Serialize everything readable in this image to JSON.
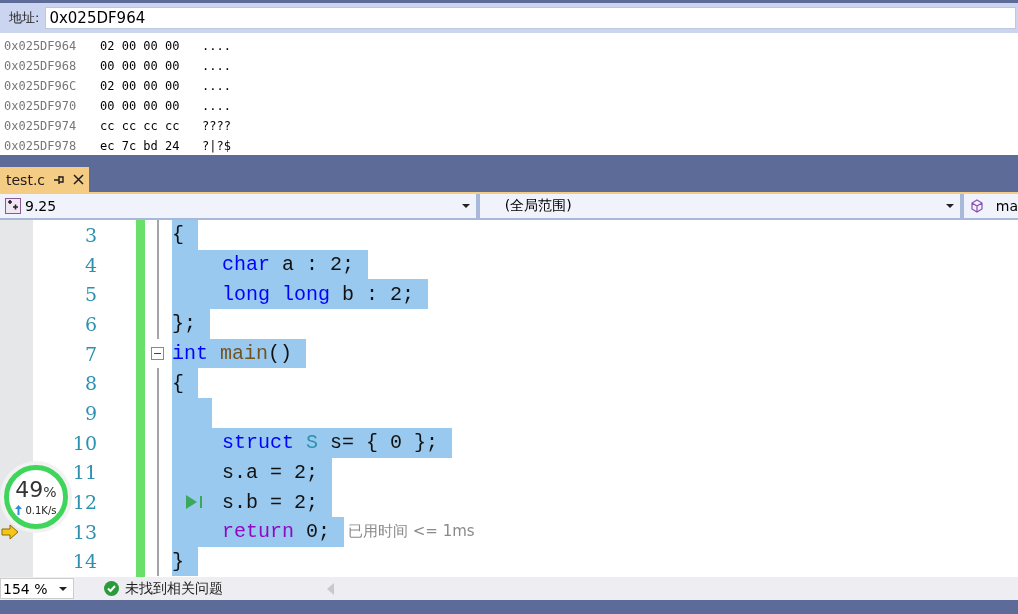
{
  "address_bar": {
    "label": "地址:",
    "value": "0x025DF964"
  },
  "memory_rows": [
    {
      "address": "0x025DF964",
      "bytes": "02 00 00 00",
      "chars": "...."
    },
    {
      "address": "0x025DF968",
      "bytes": "00 00 00 00",
      "chars": "...."
    },
    {
      "address": "0x025DF96C",
      "bytes": "02 00 00 00",
      "chars": "...."
    },
    {
      "address": "0x025DF970",
      "bytes": "00 00 00 00",
      "chars": "...."
    },
    {
      "address": "0x025DF974",
      "bytes": "cc cc cc cc",
      "chars": "????"
    },
    {
      "address": "0x025DF978",
      "bytes": "ec 7c bd 24",
      "chars": "?|?$"
    }
  ],
  "tabs": [
    {
      "label": "test.c",
      "selected": true
    }
  ],
  "nav_bar": {
    "project": "9.25",
    "scope": "(全局范围)",
    "member": "ma"
  },
  "code_lines": [
    {
      "number": "3",
      "selected": true,
      "tokens": [
        {
          "text": "{",
          "kind": "plain"
        }
      ]
    },
    {
      "number": "4",
      "selected": true,
      "indented": true,
      "tokens": [
        {
          "text": "char",
          "kind": "keyword"
        },
        {
          "text": " a : 2;",
          "kind": "plain"
        }
      ]
    },
    {
      "number": "5",
      "selected": true,
      "indented": true,
      "tokens": [
        {
          "text": "long long",
          "kind": "keyword"
        },
        {
          "text": " b : 2;",
          "kind": "plain"
        }
      ]
    },
    {
      "number": "6",
      "selected": true,
      "tokens": [
        {
          "text": "};",
          "kind": "plain"
        }
      ]
    },
    {
      "number": "7",
      "selected": true,
      "fold": true,
      "tokens": [
        {
          "text": "int ",
          "kind": "keyword"
        },
        {
          "text": "main",
          "kind": "function"
        },
        {
          "text": "()",
          "kind": "plain"
        }
      ]
    },
    {
      "number": "8",
      "selected": true,
      "tokens": [
        {
          "text": "{",
          "kind": "plain"
        }
      ]
    },
    {
      "number": "9",
      "selected": true
    },
    {
      "number": "10",
      "selected": true,
      "indented": true,
      "tokens": [
        {
          "text": "struct ",
          "kind": "keyword"
        },
        {
          "text": "S",
          "kind": "type"
        },
        {
          "text": " s= { 0 };",
          "kind": "plain"
        }
      ]
    },
    {
      "number": "11",
      "selected": true,
      "indented": true,
      "tokens": [
        {
          "text": "s.a = 2;",
          "kind": "plain"
        }
      ]
    },
    {
      "number": "12",
      "selected": true,
      "indented": true,
      "run_to": true,
      "tokens": [
        {
          "text": "s.b = 2;",
          "kind": "plain"
        }
      ]
    },
    {
      "number": "13",
      "selected": true,
      "indented": true,
      "current": true,
      "elapsed": "已用时间 <= 1ms",
      "tokens": [
        {
          "text": "return",
          "kind": "control"
        },
        {
          "text": " 0;",
          "kind": "plain"
        }
      ]
    },
    {
      "number": "14",
      "selected": true,
      "tokens": [
        {
          "text": "}",
          "kind": "plain"
        }
      ]
    }
  ],
  "status_bar": {
    "zoom": "154 %",
    "issues": "未找到相关问题"
  },
  "speed_widget": {
    "percent": "49",
    "unit": "%",
    "speed": "0.1K/s"
  }
}
